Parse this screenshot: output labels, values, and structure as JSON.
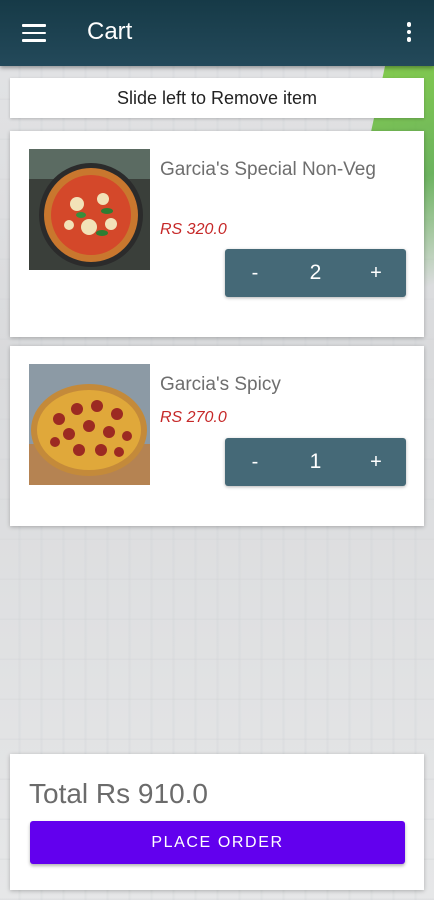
{
  "appbar": {
    "title": "Cart",
    "menu_icon": "hamburger-menu-icon",
    "more_icon": "more-vertical-icon"
  },
  "hint": "Slide left to Remove item",
  "items": [
    {
      "name": "Garcia's Special Non-Veg",
      "price": "RS 320.0",
      "quantity": "2",
      "minus": "-",
      "plus": "+",
      "image": "pizza-margherita-image"
    },
    {
      "name": "Garcia's Spicy",
      "price": "RS 270.0",
      "quantity": "1",
      "minus": "-",
      "plus": "+",
      "image": "pizza-pepperoni-image"
    }
  ],
  "footer": {
    "total": "Total Rs 910.0",
    "place_order": "PLACE ORDER"
  },
  "colors": {
    "appbar": "#1d4251",
    "stepper": "#456977",
    "price": "#c62828",
    "button": "#6200ee"
  }
}
